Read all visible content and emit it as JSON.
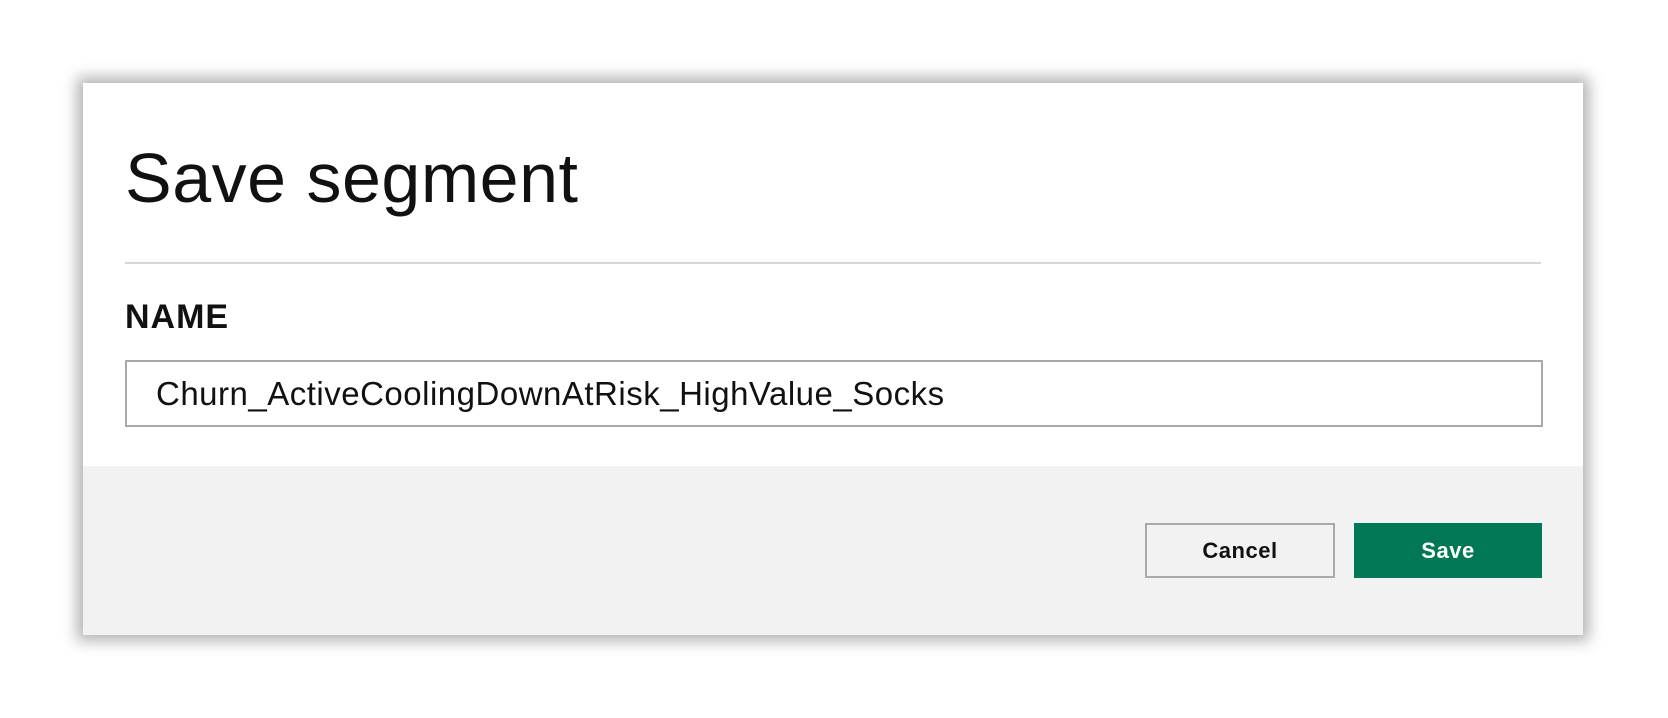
{
  "dialog": {
    "title": "Save segment",
    "name_label": "NAME",
    "name_value": "Churn_ActiveCoolingDownAtRisk_HighValue_Socks"
  },
  "footer": {
    "cancel_label": "Cancel",
    "save_label": "Save"
  },
  "colors": {
    "primary": "#007755",
    "footer_bg": "#f1f2f1",
    "border": "#a9a9a9"
  }
}
